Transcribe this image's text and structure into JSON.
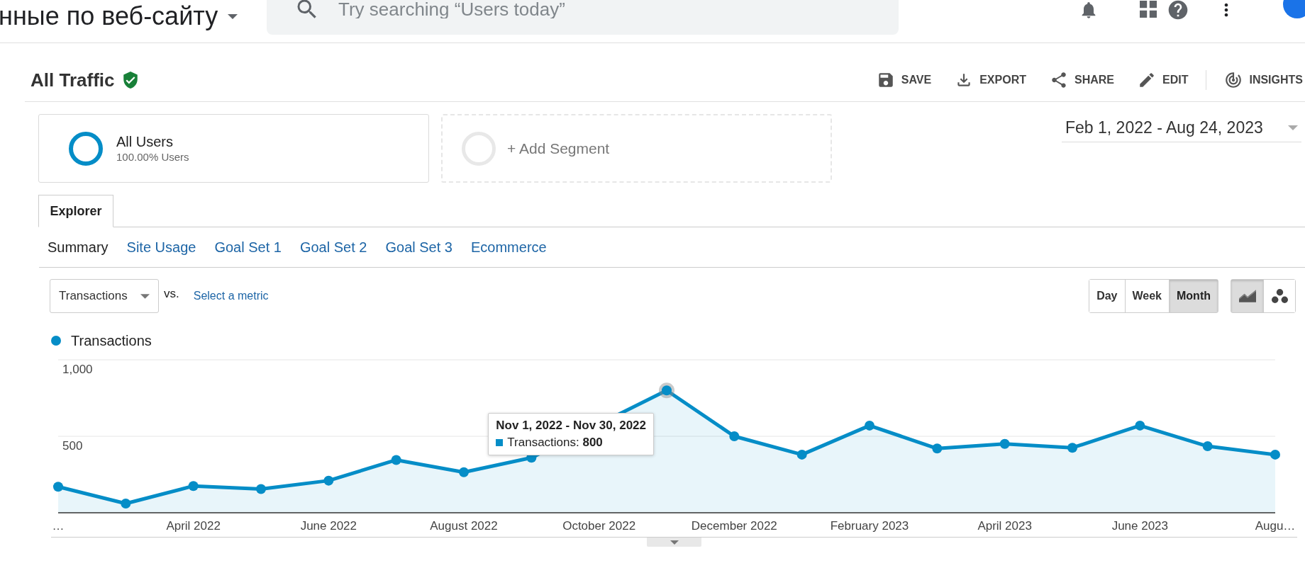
{
  "top_bar": {
    "title": "нные по веб-сайту",
    "search": {
      "placeholder": "Try searching “Users today”"
    }
  },
  "header": {
    "title": "All Traffic",
    "actions": [
      {
        "kind": "save",
        "label": "SAVE"
      },
      {
        "kind": "export",
        "label": "EXPORT"
      },
      {
        "kind": "share",
        "label": "SHARE"
      },
      {
        "kind": "edit",
        "label": "EDIT"
      },
      {
        "kind": "insights",
        "label": "INSIGHTS"
      }
    ]
  },
  "segments": [
    {
      "kind": "segment",
      "name": "All Users",
      "detail": "100.00% Users"
    },
    {
      "kind": "add",
      "label": "+ Add Segment"
    }
  ],
  "date_range": "Feb 1, 2022 - Aug 24, 2023",
  "tabs": [
    {
      "label": "Explorer",
      "selected": true
    }
  ],
  "report_tabs": [
    {
      "label": "Summary",
      "selected": true
    },
    {
      "label": "Site Usage",
      "selected": false
    },
    {
      "label": "Goal Set 1",
      "selected": false
    },
    {
      "label": "Goal Set 2",
      "selected": false
    },
    {
      "label": "Goal Set 3",
      "selected": false
    },
    {
      "label": "Ecommerce",
      "selected": false
    }
  ],
  "metric_bar": {
    "metric": "Transactions",
    "vs": "vs.",
    "compare_link": "Select a metric",
    "periods": [
      {
        "label": "Day",
        "selected": false
      },
      {
        "label": "Week",
        "selected": false
      },
      {
        "label": "Month",
        "selected": true
      }
    ],
    "chart_types": [
      {
        "kind": "line",
        "selected": true
      },
      {
        "kind": "motion",
        "selected": false
      }
    ]
  },
  "chart": {
    "tooltip": {
      "title": "Nov 1, 2022 - Nov 30, 2022",
      "text": "Transactions: **800**"
    },
    "points": [
      {
        "hovered": false
      },
      {
        "hovered": false
      },
      {
        "hovered": false
      },
      {
        "hovered": false
      },
      {
        "hovered": false
      },
      {
        "hovered": false
      },
      {
        "hovered": false
      },
      {
        "hovered": false
      },
      {
        "hovered": true
      },
      {
        "hovered": false
      },
      {
        "hovered": false
      },
      {
        "hovered": false
      },
      {
        "hovered": false
      },
      {
        "hovered": false
      },
      {
        "hovered": false
      },
      {
        "hovered": false
      },
      {
        "hovered": false
      },
      {
        "hovered": false
      }
    ],
    "chart_data": {
      "type": "area",
      "categories": [
        "…",
        null,
        "April 2022",
        null,
        "June 2022",
        null,
        "August 2022",
        null,
        "October 2022",
        null,
        "December 2022",
        null,
        "February 2023",
        null,
        "April 2023",
        null,
        "June 2023",
        null,
        "Augu…"
      ],
      "ylim": [
        0,
        1000
      ],
      "yticks": [
        {
          "value": 500,
          "label": "500"
        },
        {
          "value": 1000,
          "label": "1,000"
        }
      ],
      "series": [
        {
          "name": "Transactions",
          "color": "#058dc7",
          "values": [
            170,
            60,
            175,
            155,
            210,
            345,
            265,
            360,
            null,
            800,
            500,
            380,
            570,
            420,
            450,
            425,
            570,
            435,
            380
          ]
        }
      ]
    }
  }
}
